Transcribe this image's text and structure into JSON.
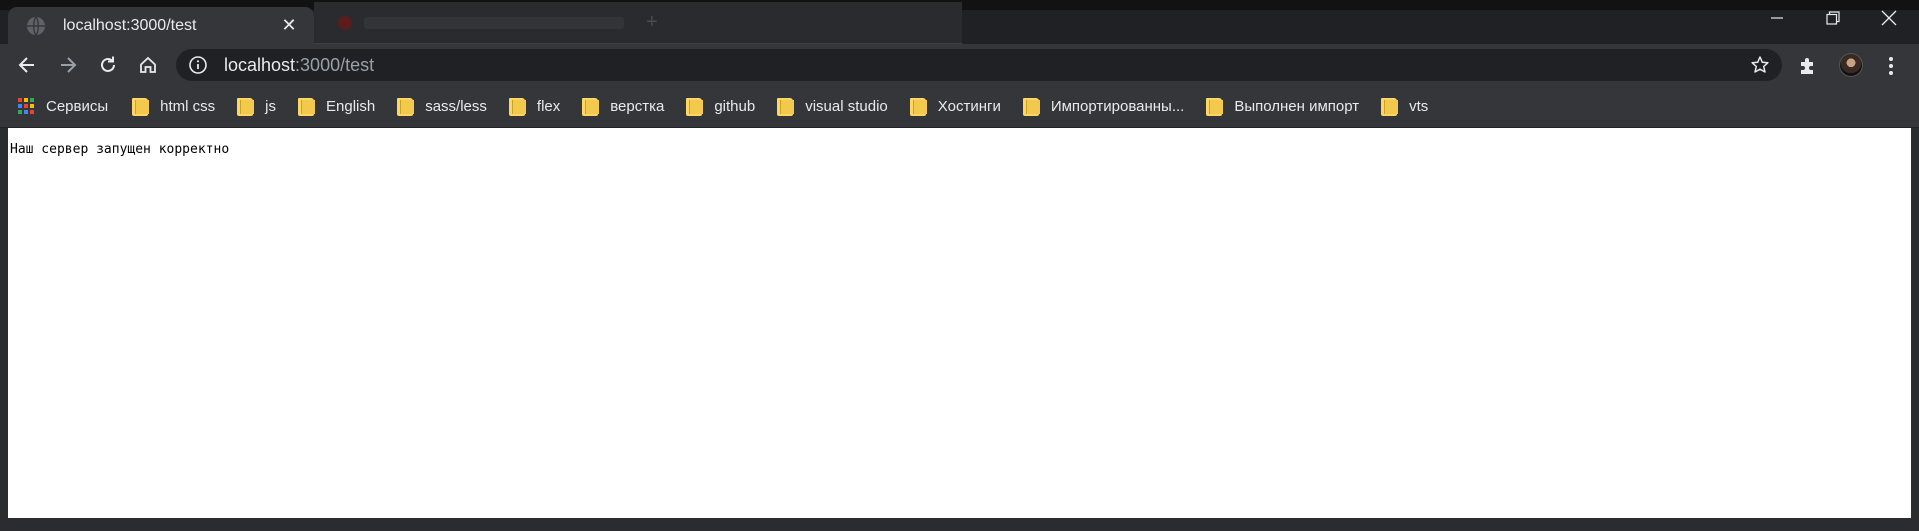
{
  "tab": {
    "title": "localhost:3000/test",
    "close_symbol": "✕",
    "favicon": "globe-icon"
  },
  "window_controls": [
    "minimize-icon",
    "restore-icon",
    "close-icon"
  ],
  "toolbar": {
    "back": "arrow-left-icon",
    "forward": "arrow-right-icon",
    "reload": "reload-icon",
    "home": "home-icon"
  },
  "omnibox": {
    "url_host": "localhost",
    "url_rest": ":3000/test",
    "info_icon": "info-icon",
    "star_icon": "star-icon"
  },
  "bookmarks": {
    "apps_label": "Сервисы",
    "items": [
      {
        "label": "html css"
      },
      {
        "label": "js"
      },
      {
        "label": "English"
      },
      {
        "label": "sass/less"
      },
      {
        "label": "flex"
      },
      {
        "label": "верстка"
      },
      {
        "label": "github"
      },
      {
        "label": "visual studio"
      },
      {
        "label": "Хостинги"
      },
      {
        "label": "Импортированны..."
      },
      {
        "label": "Выполнен импорт"
      },
      {
        "label": "vts"
      }
    ]
  },
  "page": {
    "text": "Наш сервер запущен корректно"
  },
  "colors": {
    "chrome_dark": "#202124",
    "toolbar": "#35363a",
    "folder": "#fdd663",
    "page_bg": "#ffffff"
  }
}
